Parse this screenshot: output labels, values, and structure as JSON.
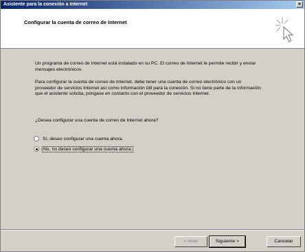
{
  "window": {
    "title": "Asistente para la conexión a Internet",
    "close_label": "×"
  },
  "header": {
    "title": "Configurar la cuenta de correo de Internet"
  },
  "body": {
    "paragraph1": "Un programa de correo de Internet está instalado en su PC. El correo de Internet le permite recibir y enviar mensajes electrónicos.",
    "paragraph2": "Para configurar la cuenta de correo de Internet, debe tener una cuenta de correo electrónico con un proveedor de servicios Internet así como información útil para la conexión. Si no tiene parte de la información que el asistente solicita, póngase en contacto con el proveedor de servicios Internet.",
    "question": "¿Desea configurar una cuenta de correo de Internet ahora?"
  },
  "options": [
    {
      "label": "Sí, deseo configurar una cuenta ahora.",
      "selected": false
    },
    {
      "label": "No, no deseo configurar una cuenta ahora.",
      "selected": true
    }
  ],
  "buttons": {
    "back": "< Atrás",
    "next": "Siguiente >",
    "cancel": "Cancelar"
  }
}
